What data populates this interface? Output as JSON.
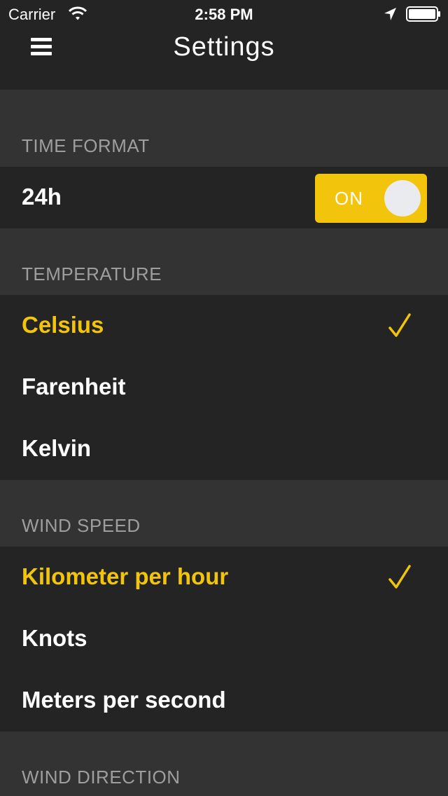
{
  "status_bar": {
    "carrier": "Carrier",
    "time": "2:58 PM",
    "icons": [
      "wifi-icon",
      "location-icon",
      "battery-icon"
    ]
  },
  "nav": {
    "title": "Settings",
    "menu_icon": "menu-icon"
  },
  "sections": {
    "time_format": {
      "header": "TIME FORMAT",
      "row_label": "24h",
      "toggle_label": "ON",
      "toggle_on": true
    },
    "temperature": {
      "header": "TEMPERATURE",
      "options": [
        "Celsius",
        "Farenheit",
        "Kelvin"
      ],
      "selected": "Celsius"
    },
    "wind_speed": {
      "header": "WIND SPEED",
      "options": [
        "Kilometer per hour",
        "Knots",
        "Meters per second"
      ],
      "selected": "Kilometer per hour"
    },
    "wind_direction": {
      "header": "WIND DIRECTION"
    }
  },
  "colors": {
    "accent": "#f2c40c",
    "background": "#333333",
    "row_background": "#242424",
    "header_text": "#9e9e9e"
  }
}
